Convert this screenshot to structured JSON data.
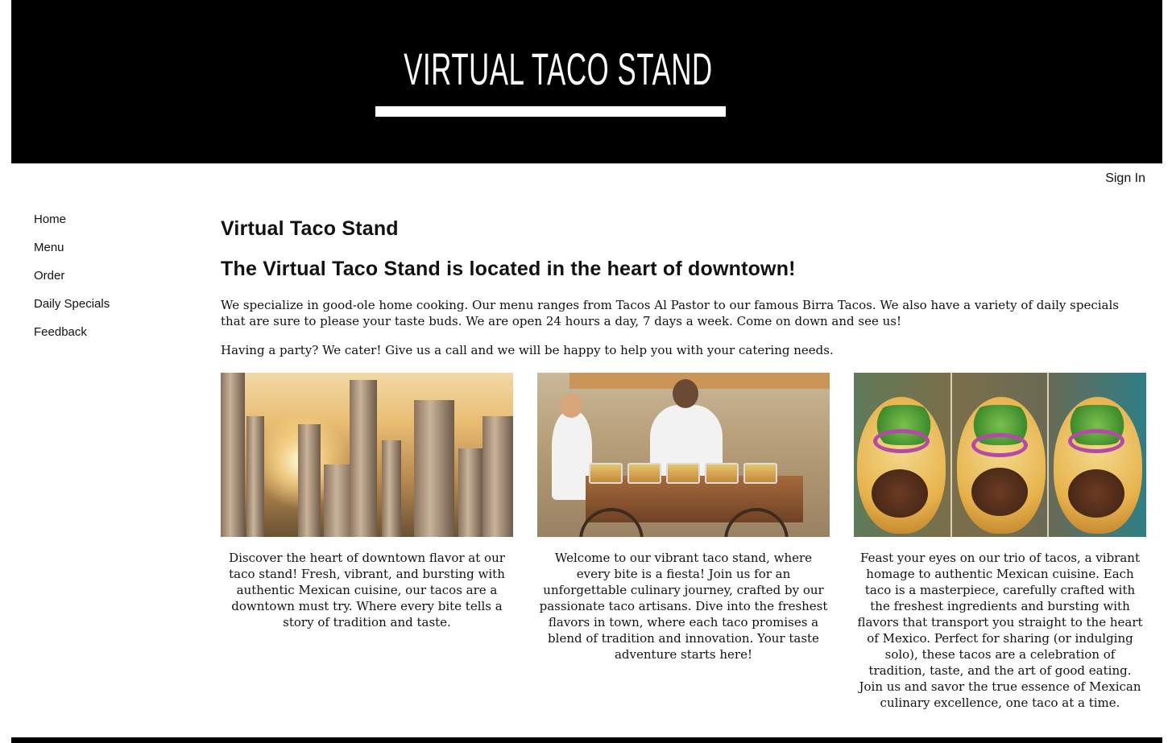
{
  "header": {
    "title": "VIRTUAL TACO STAND"
  },
  "topbar": {
    "signin_label": "Sign In"
  },
  "sidebar": {
    "items": [
      {
        "label": "Home"
      },
      {
        "label": "Menu"
      },
      {
        "label": "Order"
      },
      {
        "label": "Daily Specials"
      },
      {
        "label": "Feedback"
      }
    ]
  },
  "main": {
    "title": "Virtual Taco Stand",
    "subtitle": "The Virtual Taco Stand is located in the heart of downtown!",
    "intro": "We specialize in good-ole home cooking. Our menu ranges from Tacos Al Pastor to our famous Birra Tacos. We also have a variety of daily specials that are sure to please your taste buds. We are open 24 hours a day, 7 days a week. Come on down and see us!",
    "catering": "Having a party? We cater! Give us a call and we will be happy to help you with your catering needs."
  },
  "cards": [
    {
      "image": "city-skyline-image",
      "caption": "Discover the heart of downtown flavor at our taco stand! Fresh, vibrant, and bursting with authentic Mexican cuisine, our tacos are a downtown must try. Where every bite tells a story of tradition and taste."
    },
    {
      "image": "taco-cart-image",
      "caption": "Welcome to our vibrant taco stand, where every bite is a fiesta! Join us for an unforgettable culinary journey, crafted by our passionate taco artisans. Dive into the freshest flavors in town, where each taco promises a blend of tradition and innovation. Your taste adventure starts here!"
    },
    {
      "image": "tacos-trio-image",
      "caption": "Feast your eyes on our trio of tacos, a vibrant homage to authentic Mexican cuisine. Each taco is a masterpiece, carefully crafted with the freshest ingredients and bursting with flavors that transport you straight to the heart of Mexico. Perfect for sharing (or indulging solo), these tacos are a celebration of tradition, taste, and the art of good eating. Join us and savor the true essence of Mexican culinary excellence, one taco at a time."
    }
  ],
  "colors": {
    "banner_bg": "#000000",
    "banner_text": "#ffffff",
    "page_bg": "#ffffff",
    "text": "#111111"
  }
}
